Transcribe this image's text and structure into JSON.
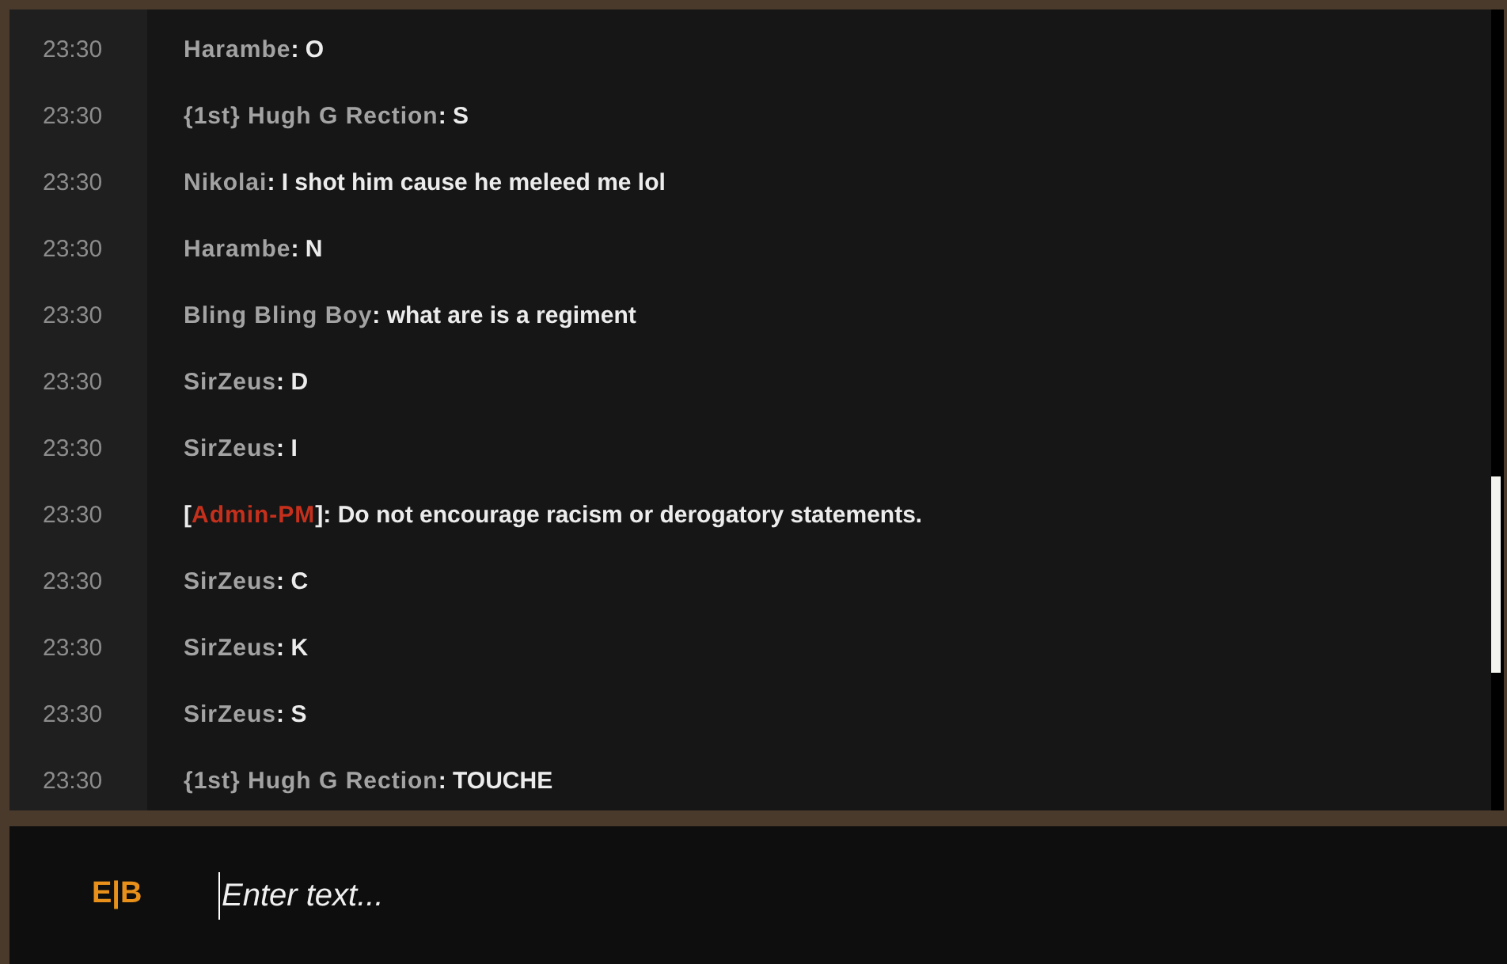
{
  "chat": {
    "messages": [
      {
        "time": "23:30",
        "parts": [
          {
            "kind": "name",
            "text": "Harambe"
          },
          {
            "kind": "plain",
            "text": ": O"
          }
        ]
      },
      {
        "time": "23:30",
        "parts": [
          {
            "kind": "name",
            "text": "{1st} Hugh G Rection"
          },
          {
            "kind": "plain",
            "text": ": S"
          }
        ]
      },
      {
        "time": "23:30",
        "parts": [
          {
            "kind": "name",
            "text": "Nikolai"
          },
          {
            "kind": "plain",
            "text": ": I shot him cause he meleed me lol"
          }
        ]
      },
      {
        "time": "23:30",
        "parts": [
          {
            "kind": "name",
            "text": "Harambe"
          },
          {
            "kind": "plain",
            "text": ": N"
          }
        ]
      },
      {
        "time": "23:30",
        "parts": [
          {
            "kind": "name",
            "text": "Bling Bling Boy"
          },
          {
            "kind": "plain",
            "text": ": what are is a regiment"
          }
        ]
      },
      {
        "time": "23:30",
        "parts": [
          {
            "kind": "name",
            "text": "SirZeus"
          },
          {
            "kind": "plain",
            "text": ": D"
          }
        ]
      },
      {
        "time": "23:30",
        "parts": [
          {
            "kind": "name",
            "text": "SirZeus"
          },
          {
            "kind": "plain",
            "text": ": I"
          }
        ]
      },
      {
        "time": "23:30",
        "parts": [
          {
            "kind": "plain",
            "text": "["
          },
          {
            "kind": "admin",
            "text": "Admin-PM"
          },
          {
            "kind": "plain",
            "text": "]: Do not encourage racism or derogatory statements."
          }
        ]
      },
      {
        "time": "23:30",
        "parts": [
          {
            "kind": "name",
            "text": "SirZeus"
          },
          {
            "kind": "plain",
            "text": ": C"
          }
        ]
      },
      {
        "time": "23:30",
        "parts": [
          {
            "kind": "name",
            "text": "SirZeus"
          },
          {
            "kind": "plain",
            "text": ": K"
          }
        ]
      },
      {
        "time": "23:30",
        "parts": [
          {
            "kind": "name",
            "text": "SirZeus"
          },
          {
            "kind": "plain",
            "text": ": S"
          }
        ]
      },
      {
        "time": "23:30",
        "parts": [
          {
            "kind": "name",
            "text": "{1st} Hugh G Rection"
          },
          {
            "kind": "plain",
            "text": ": TOUCHE"
          }
        ]
      }
    ]
  },
  "input_bar": {
    "channel": "E|B",
    "placeholder": "Enter text..."
  }
}
